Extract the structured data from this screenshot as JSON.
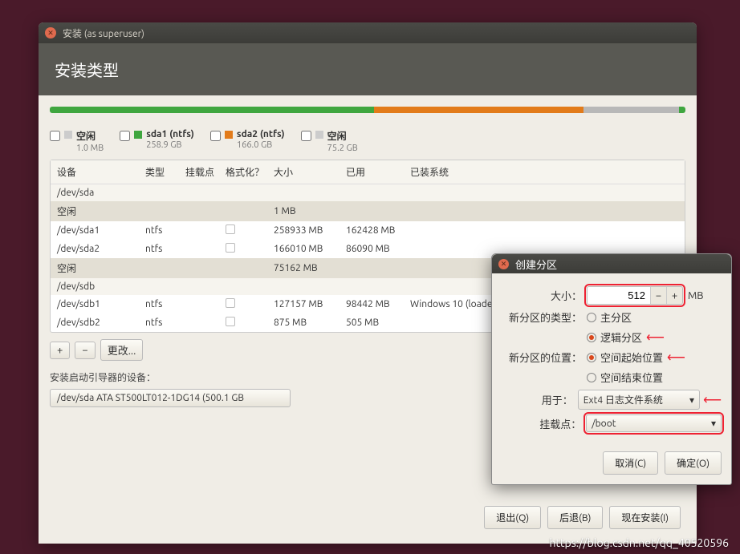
{
  "window": {
    "title": "安装 (as superuser)",
    "heading": "安装类型"
  },
  "legend": {
    "items": [
      {
        "label": "空闲",
        "sub": "1.0 MB",
        "color": "#cccccc",
        "checked": false
      },
      {
        "label": "sda1 (ntfs)",
        "sub": "258.9 GB",
        "color": "#3fa63f",
        "checked": false
      },
      {
        "label": "sda2 (ntfs)",
        "sub": "166.0 GB",
        "color": "#e27b1a",
        "checked": false
      },
      {
        "label": "空闲",
        "sub": "75.2 GB",
        "color": "#cccccc",
        "checked": false
      }
    ]
  },
  "bar_segments": [
    {
      "color": "#3fa63f",
      "pct": 51
    },
    {
      "color": "#e27b1a",
      "pct": 33
    },
    {
      "color": "#b8b8b8",
      "pct": 15
    },
    {
      "color": "#3fa63f",
      "pct": 1
    }
  ],
  "table": {
    "headers": [
      "设备",
      "类型",
      "挂载点",
      "格式化？",
      "大小",
      "已用",
      "已装系统"
    ],
    "rows": [
      {
        "kind": "group",
        "c": [
          "/dev/sda",
          "",
          "",
          "",
          "",
          "",
          ""
        ]
      },
      {
        "kind": "hl",
        "c": [
          "空闲",
          "",
          "",
          "",
          "1 MB",
          "",
          ""
        ]
      },
      {
        "kind": "row",
        "c": [
          "/dev/sda1",
          "ntfs",
          "",
          "",
          "258933 MB",
          "162428 MB",
          ""
        ]
      },
      {
        "kind": "row",
        "c": [
          "/dev/sda2",
          "ntfs",
          "",
          "",
          "166010 MB",
          "86090 MB",
          ""
        ]
      },
      {
        "kind": "hl",
        "c": [
          "空闲",
          "",
          "",
          "",
          "75162 MB",
          "",
          ""
        ]
      },
      {
        "kind": "group",
        "c": [
          "/dev/sdb",
          "",
          "",
          "",
          "",
          "",
          ""
        ]
      },
      {
        "kind": "row",
        "c": [
          "/dev/sdb1",
          "ntfs",
          "",
          "",
          "127157 MB",
          "98442 MB",
          "Windows 10 (loader)"
        ]
      },
      {
        "kind": "row",
        "c": [
          "/dev/sdb2",
          "ntfs",
          "",
          "",
          "875 MB",
          "505 MB",
          ""
        ]
      }
    ]
  },
  "toolbar": {
    "plus": "+",
    "minus": "−",
    "change": "更改..."
  },
  "bootloader": {
    "label": "安装启动引导器的设备：",
    "value": "/dev/sda   ATA ST500LT012-1DG14 (500.1 GB"
  },
  "footer": {
    "quit": "退出(Q)",
    "back": "后退(B)",
    "install": "现在安装(I)"
  },
  "dialog": {
    "title": "创建分区",
    "size_label": "大小：",
    "size_value": "512",
    "size_unit": "MB",
    "type_label": "新分区的类型：",
    "type_primary": "主分区",
    "type_logical": "逻辑分区",
    "pos_label": "新分区的位置：",
    "pos_begin": "空间起始位置",
    "pos_end": "空间结束位置",
    "use_label": "用于：",
    "use_value": "Ext4 日志文件系统",
    "mount_label": "挂载点：",
    "mount_value": "/boot",
    "cancel": "取消(C)",
    "ok": "确定(O)"
  },
  "watermark": "https://blog.csdn.net/qq_40520596"
}
